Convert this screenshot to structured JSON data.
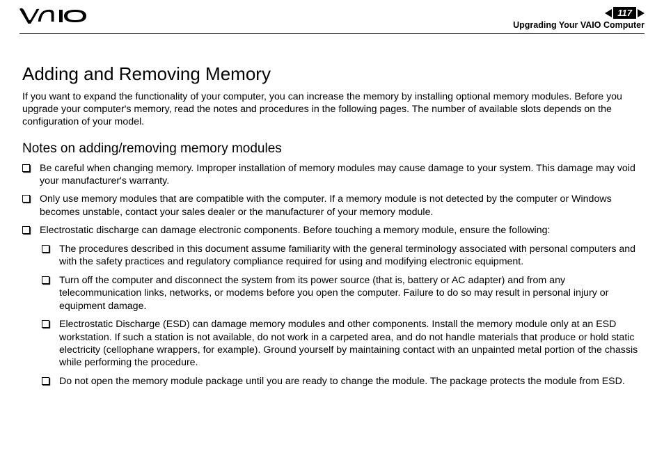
{
  "header": {
    "page_number": "117",
    "section": "Upgrading Your VAIO Computer"
  },
  "main": {
    "h1": "Adding and Removing Memory",
    "intro": "If you want to expand the functionality of your computer, you can increase the memory by installing optional memory modules. Before you upgrade your computer's memory, read the notes and procedures in the following pages. The number of available slots depends on the configuration of your model.",
    "h2": "Notes on adding/removing memory modules",
    "bullets": [
      "Be careful when changing memory. Improper installation of memory modules may cause damage to your system. This damage may void your manufacturer's warranty.",
      "Only use memory modules that are compatible with the computer. If a memory module is not detected by the computer or Windows becomes unstable, contact your sales dealer or the manufacturer of your memory module.",
      "Electrostatic discharge can damage electronic components. Before touching a memory module, ensure the following:"
    ],
    "sub_bullets": [
      "The procedures described in this document assume familiarity with the general terminology associated with personal computers and with the safety practices and regulatory compliance required for using and modifying electronic equipment.",
      "Turn off the computer and disconnect the system from its power source (that is, battery or AC adapter) and from any telecommunication links, networks, or modems before you open the computer. Failure to do so may result in personal injury or equipment damage.",
      "Electrostatic Discharge (ESD) can damage memory modules and other components. Install the memory module only at an ESD workstation. If such a station is not available, do not work in a carpeted area, and do not handle materials that produce or hold static electricity (cellophane wrappers, for example). Ground yourself by maintaining contact with an unpainted metal portion of the chassis while performing the procedure.",
      "Do not open the memory module package until you are ready to change the module. The package protects the module from ESD."
    ]
  }
}
